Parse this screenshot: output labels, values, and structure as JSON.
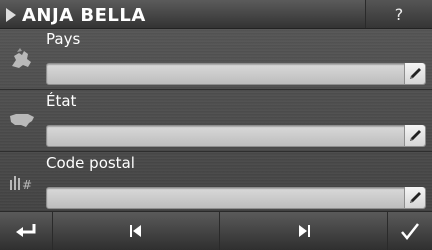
{
  "header": {
    "title": "ANJA BELLA",
    "help_label": "?"
  },
  "rows": [
    {
      "label": "Pays",
      "value": ""
    },
    {
      "label": "État",
      "value": ""
    },
    {
      "label": "Code postal",
      "value": ""
    }
  ],
  "footer": {
    "buttons": [
      "back",
      "previous",
      "next",
      "confirm"
    ]
  },
  "icons": {
    "header": "play-icon",
    "row_0": "europe-map-icon",
    "row_1": "usa-map-icon",
    "row_2": "postal-code-icon",
    "edit": "pencil-icon"
  },
  "colors": {
    "field_bg": "#d0d0d0",
    "background": "#4a4a4a",
    "text": "#ffffff"
  }
}
